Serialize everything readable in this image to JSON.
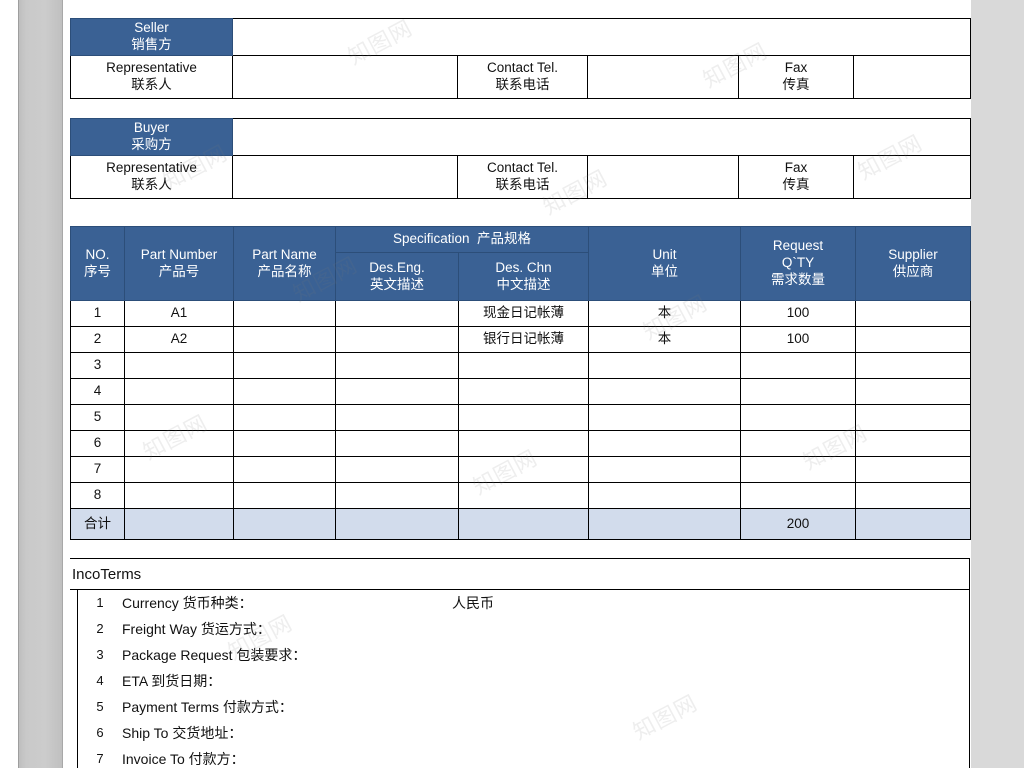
{
  "document": {
    "type": "purchase-order-form",
    "language": "bilingual-en-zh"
  },
  "parties": [
    {
      "block_label_en": "Seller",
      "block_label_cn": "销售方",
      "block_value": "",
      "rep_label_en": "Representative",
      "rep_label_cn": "联系人",
      "rep_value": "",
      "tel_label_en": "Contact Tel.",
      "tel_label_cn": "联系电话",
      "tel_value": "",
      "fax_label_en": "Fax",
      "fax_label_cn": "传真",
      "fax_value": ""
    },
    {
      "block_label_en": "Buyer",
      "block_label_cn": "采购方",
      "block_value": "",
      "rep_label_en": "Representative",
      "rep_label_cn": "联系人",
      "rep_value": "",
      "tel_label_en": "Contact Tel.",
      "tel_label_cn": "联系电话",
      "tel_value": "",
      "fax_label_en": "Fax",
      "fax_label_cn": "传真",
      "fax_value": ""
    }
  ],
  "items_table": {
    "headers": {
      "no_en": "NO.",
      "no_cn": "序号",
      "part_number_en": "Part Number",
      "part_number_cn": "产品号",
      "part_name_en": "Part Name",
      "part_name_cn": "产品名称",
      "spec_group_en": "Specification",
      "spec_group_cn": "产品规格",
      "des_eng_en": "Des.Eng.",
      "des_eng_cn": "英文描述",
      "des_chn_en": "Des. Chn",
      "des_chn_cn": "中文描述",
      "unit_en": "Unit",
      "unit_cn": "单位",
      "qty_en1": "Request",
      "qty_en2": "Q`TY",
      "qty_cn": "需求数量",
      "supplier_en": "Supplier",
      "supplier_cn": "供应商"
    },
    "rows": [
      {
        "no": "1",
        "part_number": "A1",
        "part_name": "",
        "des_eng": "",
        "des_chn": "现金日记帐薄",
        "unit": "本",
        "qty": "100",
        "supplier": ""
      },
      {
        "no": "2",
        "part_number": "A2",
        "part_name": "",
        "des_eng": "",
        "des_chn": "银行日记帐薄",
        "unit": "本",
        "qty": "100",
        "supplier": ""
      },
      {
        "no": "3",
        "part_number": "",
        "part_name": "",
        "des_eng": "",
        "des_chn": "",
        "unit": "",
        "qty": "",
        "supplier": ""
      },
      {
        "no": "4",
        "part_number": "",
        "part_name": "",
        "des_eng": "",
        "des_chn": "",
        "unit": "",
        "qty": "",
        "supplier": ""
      },
      {
        "no": "5",
        "part_number": "",
        "part_name": "",
        "des_eng": "",
        "des_chn": "",
        "unit": "",
        "qty": "",
        "supplier": ""
      },
      {
        "no": "6",
        "part_number": "",
        "part_name": "",
        "des_eng": "",
        "des_chn": "",
        "unit": "",
        "qty": "",
        "supplier": ""
      },
      {
        "no": "7",
        "part_number": "",
        "part_name": "",
        "des_eng": "",
        "des_chn": "",
        "unit": "",
        "qty": "",
        "supplier": ""
      },
      {
        "no": "8",
        "part_number": "",
        "part_name": "",
        "des_eng": "",
        "des_chn": "",
        "unit": "",
        "qty": "",
        "supplier": ""
      }
    ],
    "total_row": {
      "label": "合计",
      "part_number": "",
      "part_name": "",
      "des_eng": "",
      "des_chn": "",
      "unit": "",
      "qty": "200",
      "supplier": ""
    }
  },
  "incoterms": {
    "title": "IncoTerms",
    "rows": [
      {
        "num": "1",
        "label": "Currency 货币种类：",
        "value": "人民币"
      },
      {
        "num": "2",
        "label": "Freight Way 货运方式：",
        "value": ""
      },
      {
        "num": "3",
        "label": "Package Request 包装要求：",
        "value": ""
      },
      {
        "num": "4",
        "label": "ETA 到货日期：",
        "value": ""
      },
      {
        "num": "5",
        "label": "Payment Terms 付款方式：",
        "value": ""
      },
      {
        "num": "6",
        "label": "Ship To 交货地址：",
        "value": ""
      },
      {
        "num": "7",
        "label": "Invoice To 付款方：",
        "value": ""
      }
    ]
  },
  "colors": {
    "header_blue": "#3a6194",
    "total_row_blue": "#d2dcec",
    "gutter_gray": "#cccccc",
    "right_panel_gray": "#d9d9d9",
    "text": "#111111"
  },
  "watermarks": [
    "知图网",
    "知图网",
    "知图网",
    "知图网",
    "知图网",
    "知图网",
    "知图网",
    "知图网",
    "知图网",
    "知图网",
    "知图网",
    "知图网"
  ]
}
